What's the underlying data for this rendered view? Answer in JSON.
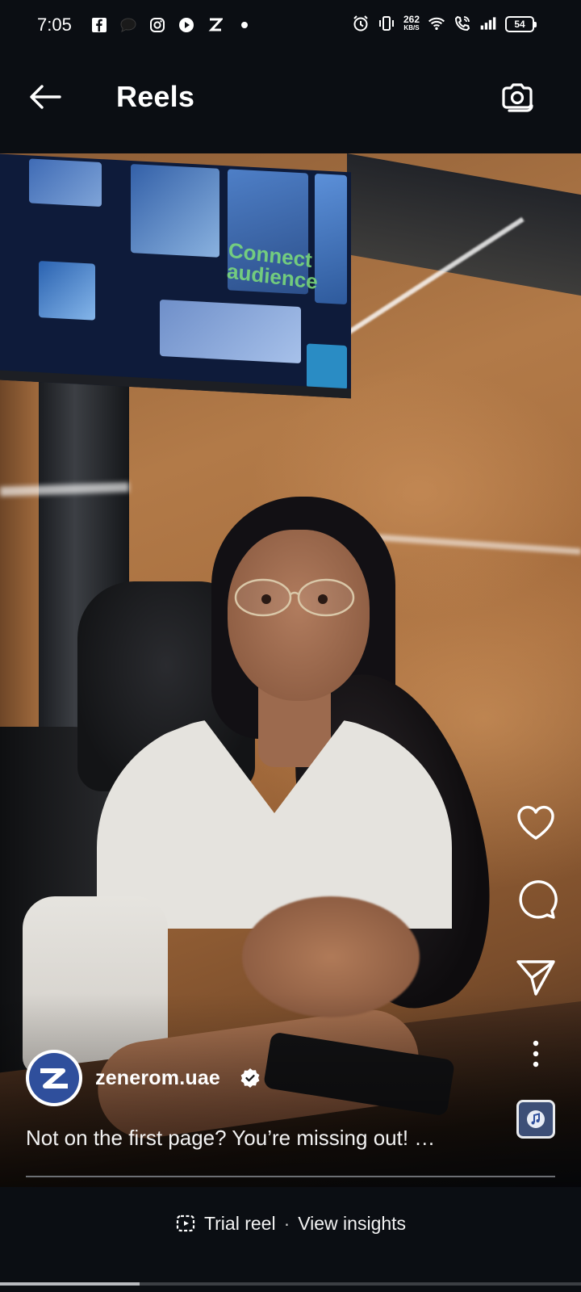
{
  "status_bar": {
    "time": "7:05",
    "net_speed_value": "262",
    "net_speed_unit": "KB/S",
    "battery": "54",
    "left_icons": [
      "facebook-icon",
      "chat-bubble-icon",
      "instagram-icon",
      "play-icon",
      "z-icon",
      "dot-icon"
    ],
    "right_icons": [
      "alarm-icon",
      "vibrate-icon",
      "wifi-icon",
      "wifi-call-icon",
      "signal-icon"
    ]
  },
  "header": {
    "title": "Reels",
    "back_icon": "arrow-left-icon",
    "camera_icon": "camera-icon"
  },
  "video": {
    "tv_text": "Connect\naudience"
  },
  "actions": {
    "like": "heart-icon",
    "comment": "comment-icon",
    "share": "send-icon",
    "more": "more-vertical-icon",
    "audio": "audio-thumbnail"
  },
  "reel": {
    "username": "zenerom.uae",
    "verified": true,
    "caption": "Not on the first page? You’re missing out! …"
  },
  "bottom": {
    "trial_label": "Trial reel",
    "separator": "·",
    "insights_label": "View insights",
    "progress": 0.24
  },
  "colors": {
    "background": "#0b0e13",
    "text": "#ffffff",
    "brand_blue": "#2f4f9c"
  }
}
